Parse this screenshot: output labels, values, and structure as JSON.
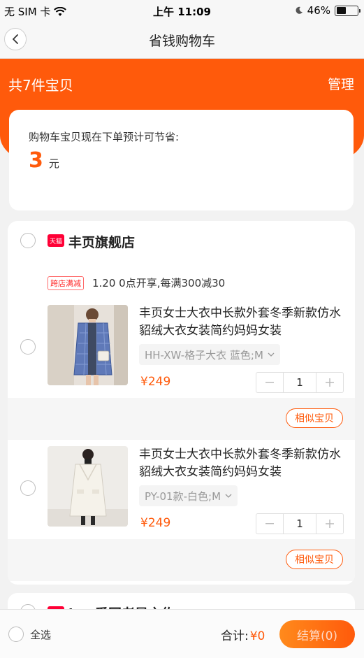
{
  "status_bar": {
    "carrier": "无 SIM 卡",
    "time": "上午 11:09",
    "battery": "46%",
    "battery_level": 0.46
  },
  "nav": {
    "title": "省钱购物车",
    "back_icon": "chevron-left-icon"
  },
  "header": {
    "count_label": "共7件宝贝",
    "manage_label": "管理",
    "accent_color": "#ff5a0b"
  },
  "savings": {
    "label": "购物车宝贝现在下单预计可节省:",
    "value": "3",
    "unit": "元"
  },
  "shop": {
    "badge": "天猫",
    "name": "丰页旗舰店",
    "promo_tag": "跨店满减",
    "promo_text": "1.20 0点开享,每满300减30",
    "items": [
      {
        "title": "丰页女士大衣中长款外套冬季新款仿水貂绒大衣女装简约妈妈女装",
        "sku": "HH-XW-格子大衣 蓝色;M",
        "price": "¥249",
        "quantity": "1",
        "similar_label": "相似宝贝"
      },
      {
        "title": "丰页女士大衣中长款外套冬季新款仿水貂绒大衣女装简约妈妈女装",
        "sku": "PY-01款-白色;M",
        "price": "¥249",
        "quantity": "1",
        "similar_label": "相似宝贝"
      }
    ]
  },
  "next_shop": {
    "name": "ins 爱国老是之佐"
  },
  "bottom": {
    "select_all": "全选",
    "total_label": "合计:",
    "total_amount": "¥0",
    "checkout_label": "结算(0)"
  }
}
